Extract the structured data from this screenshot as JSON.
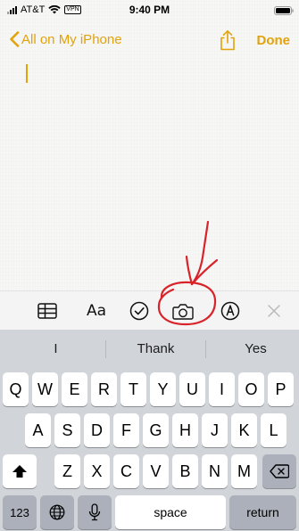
{
  "status_bar": {
    "carrier": "AT&T",
    "vpn": "VPN",
    "time": "9:40 PM"
  },
  "nav": {
    "back_label": "All on My iPhone",
    "done_label": "Done"
  },
  "note": {
    "body_text": ""
  },
  "toolbar": {
    "format_label": "Aa",
    "items": [
      "table-icon",
      "format-text",
      "checklist-icon",
      "camera-icon",
      "markup-icon",
      "close-icon"
    ]
  },
  "predictive": {
    "suggestions": [
      "I",
      "Thank",
      "Yes"
    ]
  },
  "keyboard": {
    "row1": [
      "Q",
      "W",
      "E",
      "R",
      "T",
      "Y",
      "U",
      "I",
      "O",
      "P"
    ],
    "row2": [
      "A",
      "S",
      "D",
      "F",
      "G",
      "H",
      "J",
      "K",
      "L"
    ],
    "row3": [
      "Z",
      "X",
      "C",
      "V",
      "B",
      "N",
      "M"
    ],
    "numbers_label": "123",
    "space_label": "space",
    "return_label": "return"
  },
  "colors": {
    "accent": "#e2a20c",
    "annotation": "#d8232a",
    "keyboard_bg": "#d1d4d9"
  }
}
